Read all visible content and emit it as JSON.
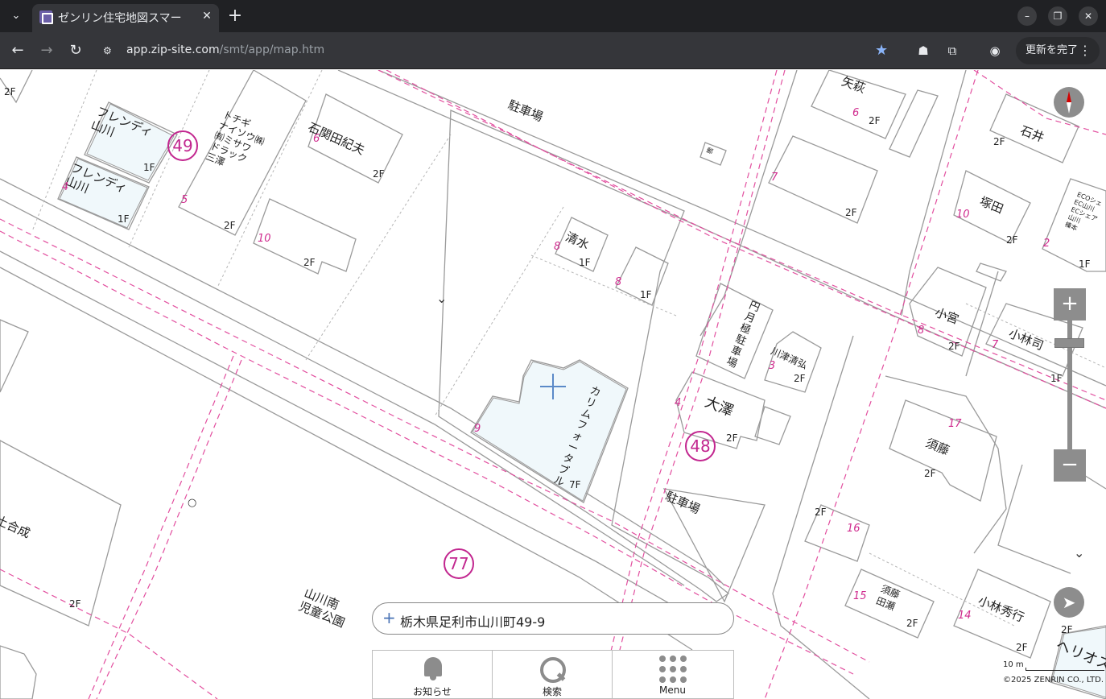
{
  "browser": {
    "tab_title": "ゼンリン住宅地図スマー",
    "url_host": "app.zip-site.com",
    "url_path": "/smt/app/map.htm",
    "update_button": "更新を完了"
  },
  "map": {
    "labels": {
      "parking_top": "駐車場",
      "parking_mid": "駐車場",
      "yano": "矢萩",
      "ishii": "石井",
      "tsukada": "塚田",
      "komiya": "小宮",
      "kobayashi_tsukasa": "小林司",
      "friendy_1": "フレンディ\n山川",
      "friendy_2": "フレンディ\n山川",
      "tochigi": "トチギ\nナイソウ㈱\n㈲ミサワ\nドラック\n三澤",
      "ishizeki": "石関田紀夫",
      "shimizu": "清水",
      "kawazu": "川津清弘",
      "osawa": "大澤",
      "sudo": "須藤",
      "sudo_tase": "須藤\n田瀬",
      "kobayashi_hideyuki": "小林秀行",
      "herios": "ヘリオス",
      "park": "山川南\n児童公園",
      "gosei": "土合成",
      "mail": "郵",
      "eco_apartments": "ECOシェ\nEC山川\nECシェア\n山川\n榛本",
      "endo_parking": "円月極駐車場",
      "karimu_table": "カリムフォータブル"
    },
    "floors": [
      "1F",
      "2F",
      "7F"
    ],
    "lot_numbers": [
      "6",
      "7",
      "10",
      "5",
      "4",
      "6",
      "10",
      "8",
      "8",
      "9",
      "3",
      "4",
      "17",
      "16",
      "15",
      "14",
      "2",
      "8",
      "7"
    ],
    "block_numbers": {
      "b49": "49",
      "b48": "48",
      "b77": "77"
    },
    "address": "栃木県足利市山川町49-9",
    "scale_label": "10 m",
    "copyright": "©2025 ZENRIN CO., LTD."
  },
  "nav": {
    "notice": "お知らせ",
    "search": "検索",
    "menu": "Menu"
  }
}
